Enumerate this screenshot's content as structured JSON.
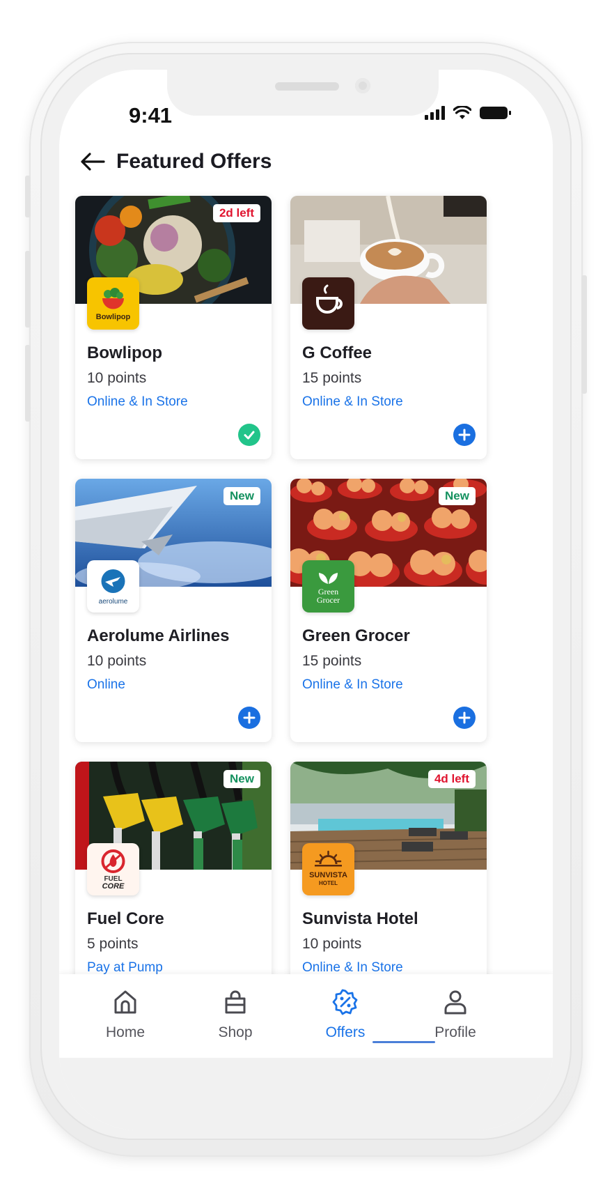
{
  "status_bar": {
    "time": "9:41"
  },
  "header": {
    "title": "Featured Offers",
    "back_icon": "arrow-left-icon"
  },
  "offers": [
    {
      "merchant": "Bowlipop",
      "points": "10 points",
      "channel": "Online & In Store",
      "badge": "2d left",
      "badge_color": "#e0142f",
      "status": "added",
      "logo_text": "Bowlipop",
      "logo_bg": "#f7c400"
    },
    {
      "merchant": "G Coffee",
      "points": "15 points",
      "channel": "Online & In Store",
      "badge": "",
      "status": "add",
      "logo_text": "",
      "logo_bg": "#3a1a14"
    },
    {
      "merchant": "Aerolume Airlines",
      "points": "10 points",
      "channel": "Online",
      "badge": "New",
      "badge_color": "#14915f",
      "status": "add",
      "logo_text": "aerolume",
      "logo_bg": "#ffffff"
    },
    {
      "merchant": "Green Grocer",
      "points": "15 points",
      "channel": "Online & In Store",
      "badge": "New",
      "badge_color": "#14915f",
      "status": "add",
      "logo_text": "Green Grocer",
      "logo_bg": "#3a9a3e"
    },
    {
      "merchant": "Fuel Core",
      "points": "5 points",
      "channel": "Pay at Pump",
      "badge": "New",
      "badge_color": "#14915f",
      "status": "add",
      "logo_text": "FUEL CORE",
      "logo_bg": "#fff5ef"
    },
    {
      "merchant": "Sunvista Hotel",
      "points": "10 points",
      "channel": "Online & In Store",
      "badge": "4d left",
      "badge_color": "#e0142f",
      "status": "add",
      "logo_text": "SUNVISTA HOTEL",
      "logo_bg": "#f59a20"
    }
  ],
  "nav": {
    "items": [
      {
        "label": "Home",
        "icon": "home-icon",
        "active": false
      },
      {
        "label": "Shop",
        "icon": "shopping-bag-icon",
        "active": false
      },
      {
        "label": "Offers",
        "icon": "discount-badge-icon",
        "active": true
      },
      {
        "label": "Profile",
        "icon": "user-icon",
        "active": false
      }
    ]
  },
  "colors": {
    "accent": "#1a73e8",
    "add_button": "#1a6fe0",
    "added_check": "#22c48a",
    "badge_urgent": "#e0142f",
    "badge_new": "#14915f"
  }
}
